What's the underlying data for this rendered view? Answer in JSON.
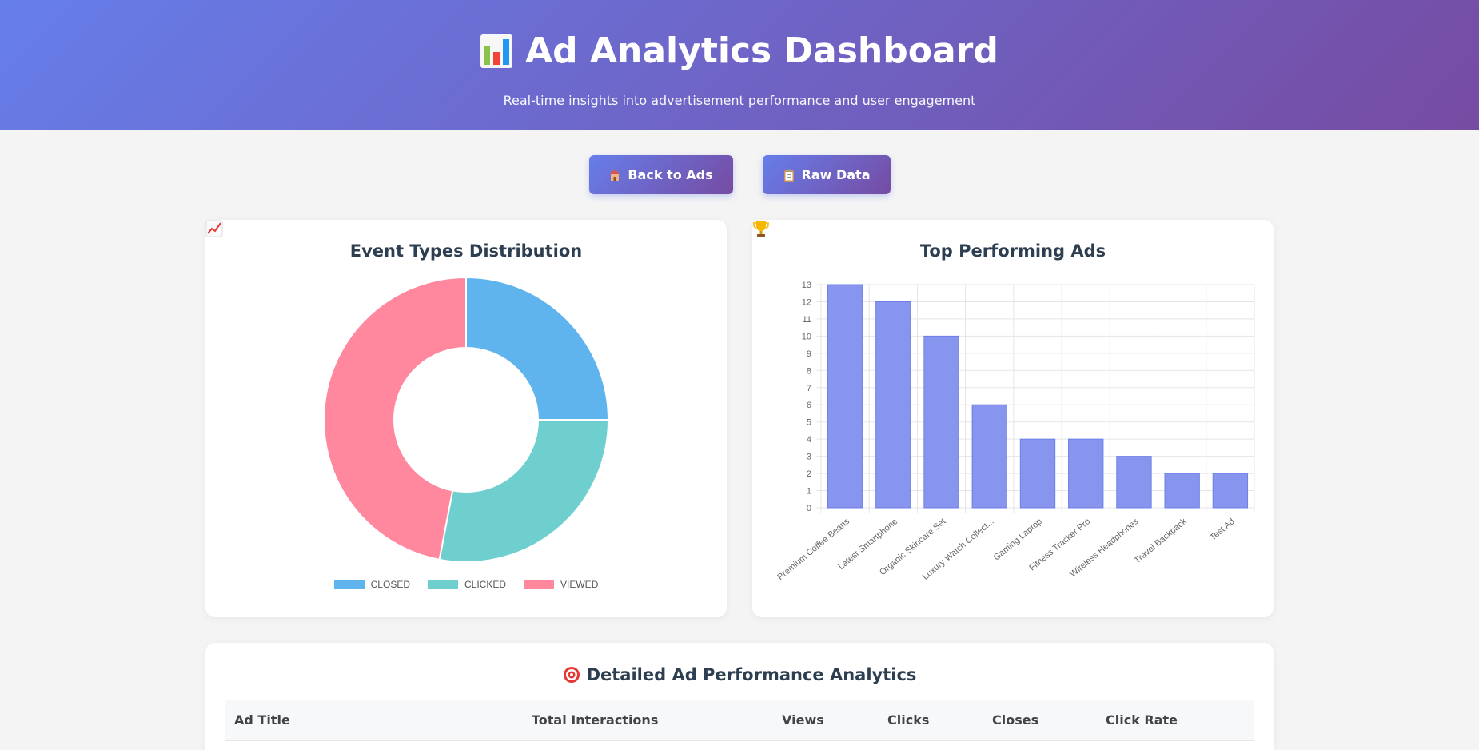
{
  "header": {
    "title": "Ad Analytics Dashboard",
    "subtitle": "Real-time insights into advertisement performance and user engagement"
  },
  "actions": {
    "back_label": "Back to Ads",
    "back_icon": "house-icon",
    "raw_label": "Raw Data",
    "raw_icon": "clipboard-icon"
  },
  "event_chart": {
    "title": "Event Types Distribution",
    "icon": "chart-increasing-icon"
  },
  "top_chart": {
    "title": "Top Performing Ads",
    "icon": "trophy-icon"
  },
  "chart_data": [
    {
      "type": "pie",
      "donut": true,
      "labels": [
        "CLOSED",
        "CLICKED",
        "VIEWED"
      ],
      "values": [
        25,
        28,
        47
      ],
      "colors": [
        "#5fb4ee",
        "#6fcfcf",
        "#ff879e"
      ],
      "legend": "bottom"
    },
    {
      "type": "bar",
      "categories": [
        "Premium Coffee Beans",
        "Latest Smartphone",
        "Organic Skincare Set",
        "Luxury Watch Collect...",
        "Gaming Laptop",
        "Fitness Tracker Pro",
        "Wireless Headphones",
        "Travel Backpack",
        "Test Ad"
      ],
      "values": [
        13,
        12,
        10,
        6,
        4,
        4,
        3,
        2,
        2
      ],
      "ylim": [
        0,
        13
      ],
      "yticks": [
        0,
        1,
        2,
        3,
        4,
        5,
        6,
        7,
        8,
        9,
        10,
        11,
        12,
        13
      ],
      "grid": true,
      "color": "#8795ee",
      "border": "#6e7fe8"
    }
  ],
  "table": {
    "title": "Detailed Ad Performance Analytics",
    "icon": "target-icon",
    "columns": [
      "Ad Title",
      "Total Interactions",
      "Views",
      "Clicks",
      "Closes",
      "Click Rate"
    ]
  }
}
